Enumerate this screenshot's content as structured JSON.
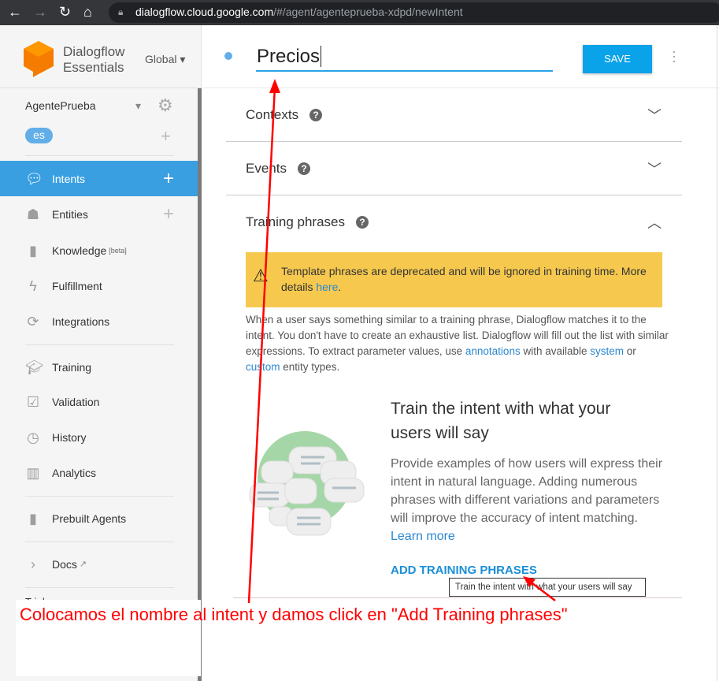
{
  "browser": {
    "url_host": "dialogflow.cloud.google.com",
    "url_path": "/#/agent/agenteprueba-xdpd/newIntent"
  },
  "brand": {
    "line1": "Dialogflow",
    "line2": "Essentials",
    "region": "Global"
  },
  "agent": {
    "name": "AgentePrueba",
    "language": "es"
  },
  "sidebar": {
    "items": [
      {
        "label": "Intents",
        "icon": "chat-icon"
      },
      {
        "label": "Entities",
        "icon": "hierarchy-icon"
      },
      {
        "label": "Knowledge",
        "badge": "[beta]",
        "icon": "book-icon"
      },
      {
        "label": "Fulfillment",
        "icon": "bolt-icon"
      },
      {
        "label": "Integrations",
        "icon": "sync-icon"
      },
      {
        "label": "Training",
        "icon": "graduation-cap-icon"
      },
      {
        "label": "Validation",
        "icon": "check-box-icon"
      },
      {
        "label": "History",
        "icon": "clock-icon"
      },
      {
        "label": "Analytics",
        "icon": "bar-chart-icon"
      },
      {
        "label": "Prebuilt Agents",
        "icon": "bookmark-icon"
      },
      {
        "label": "Docs",
        "icon": "chevron-right-icon"
      }
    ],
    "trial": "Trial"
  },
  "header": {
    "intent_name": "Precios",
    "save_label": "SAVE"
  },
  "sections": {
    "contexts": "Contexts",
    "events": "Events",
    "training": "Training phrases"
  },
  "warning": {
    "text": "Template phrases are deprecated and will be ignored in training time. More details ",
    "link": "here",
    "end": "."
  },
  "description": {
    "p1": "When a user says something similar to a training phrase, Dialogflow matches it to the intent. You don't have to create an exhaustive list. Dialogflow will fill out the list with similar expressions. To extract parameter values, use ",
    "annotations": "annotations",
    "p2": " with available ",
    "system": "system",
    "p3": " or ",
    "custom": "custom",
    "p4": " entity types."
  },
  "empty_state": {
    "title": "Train the intent with what your users will say",
    "body": "Provide examples of how users will express their intent in natural language. Adding numerous phrases with different variations and parameters will improve the accuracy of intent matching.",
    "learn_more": "Learn more",
    "add_button": "ADD TRAINING PHRASES",
    "tooltip": "Train the intent with what your users will say"
  },
  "annotation": {
    "text": "Colocamos el nombre al intent y damos click en \"Add Training phrases\"",
    "color": "#ff0000"
  }
}
